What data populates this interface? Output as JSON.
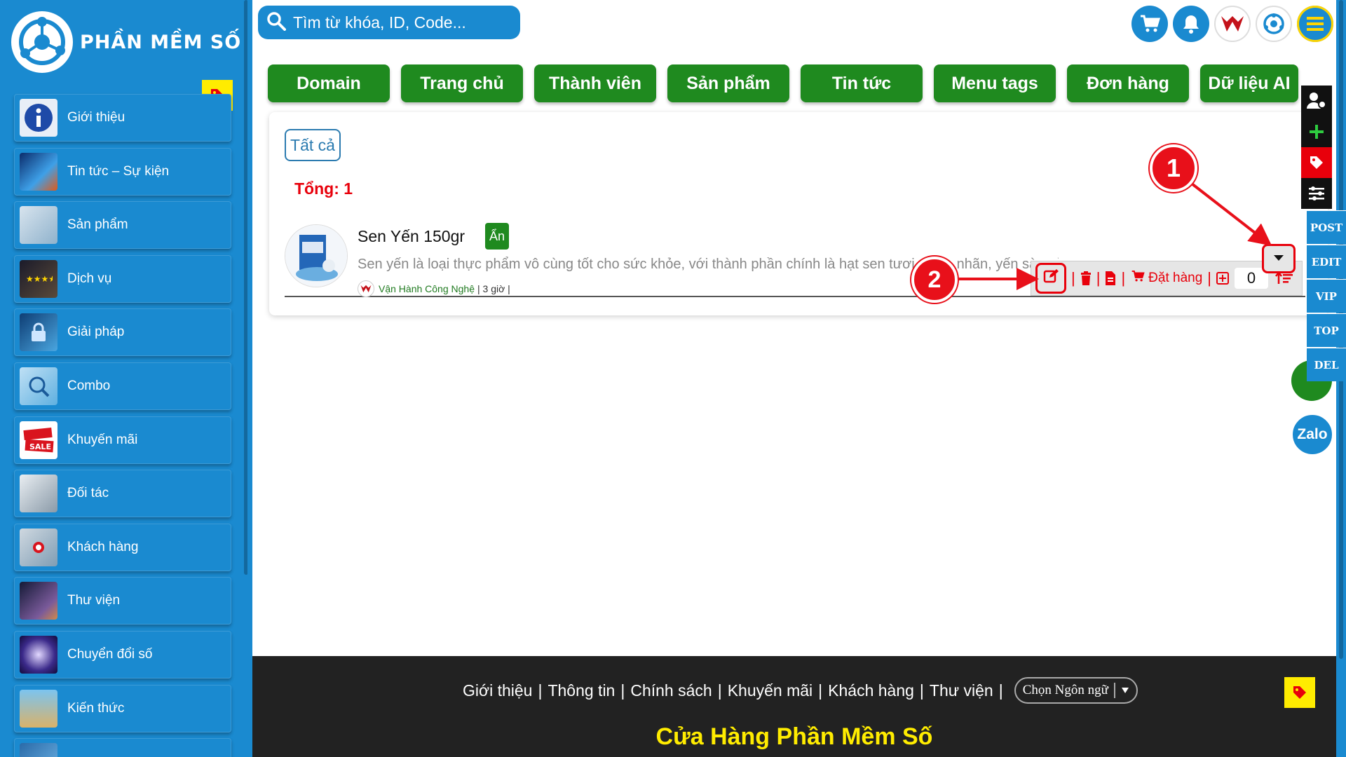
{
  "brand": {
    "name": "Phần mềm số"
  },
  "sidebar": {
    "items": [
      {
        "label": "Giới thiệu",
        "icon": "info-icon"
      },
      {
        "label": "Tin tức – Sự kiện",
        "icon": "news-icon"
      },
      {
        "label": "Sản phẩm",
        "icon": "product-icon"
      },
      {
        "label": "Dịch vụ",
        "icon": "service-icon"
      },
      {
        "label": "Giải pháp",
        "icon": "solution-icon"
      },
      {
        "label": "Combo",
        "icon": "combo-icon"
      },
      {
        "label": "Khuyến mãi",
        "icon": "sale-icon"
      },
      {
        "label": "Đối tác",
        "icon": "partner-icon"
      },
      {
        "label": "Khách hàng",
        "icon": "customer-icon"
      },
      {
        "label": "Thư viện",
        "icon": "library-icon"
      },
      {
        "label": "Chuyển đổi số",
        "icon": "digital-icon"
      },
      {
        "label": "Kiến thức",
        "icon": "knowledge-icon"
      }
    ]
  },
  "search": {
    "placeholder": "Tìm từ khóa, ID, Code..."
  },
  "nav": {
    "tabs": [
      "Domain",
      "Trang chủ",
      "Thành viên",
      "Sản phẩm",
      "Tin tức",
      "Menu tags",
      "Đơn hàng",
      "Dữ liệu AI"
    ]
  },
  "filter": {
    "all_label": "Tất cả"
  },
  "total": {
    "label": "Tổng: 1"
  },
  "product": {
    "name": "Sen Yến 150gr",
    "badge": "Ẩn",
    "description": "Sen yến là loại thực phẩm vô cùng tốt cho sức khỏe, với thành phần chính là hạt sen tươi, sâm, nhãn, yến sào và sữa tươi...",
    "author": "Vận Hành Công Nghệ",
    "meta": "| 3 giờ |"
  },
  "actions": {
    "order_label": "Đặt hàng",
    "quantity": "0"
  },
  "callouts": {
    "one": "1",
    "two": "2"
  },
  "footer": {
    "links": [
      "Giới thiệu",
      "Thông tin",
      "Chính sách",
      "Khuyến mãi",
      "Khách hàng",
      "Thư viện"
    ],
    "language_label": "Chọn Ngôn ngữ",
    "title": "Cửa Hàng Phần Mềm Số"
  },
  "side_panel": {
    "post": "POST",
    "edit": "EDIT",
    "vip": "VIP",
    "top": "TOP",
    "del": "DEL",
    "zalo": "Zalo"
  },
  "colors": {
    "primary": "#1a8ad0",
    "green": "#1f8a1f",
    "red": "#e8000b",
    "yellow": "#ffec00"
  }
}
